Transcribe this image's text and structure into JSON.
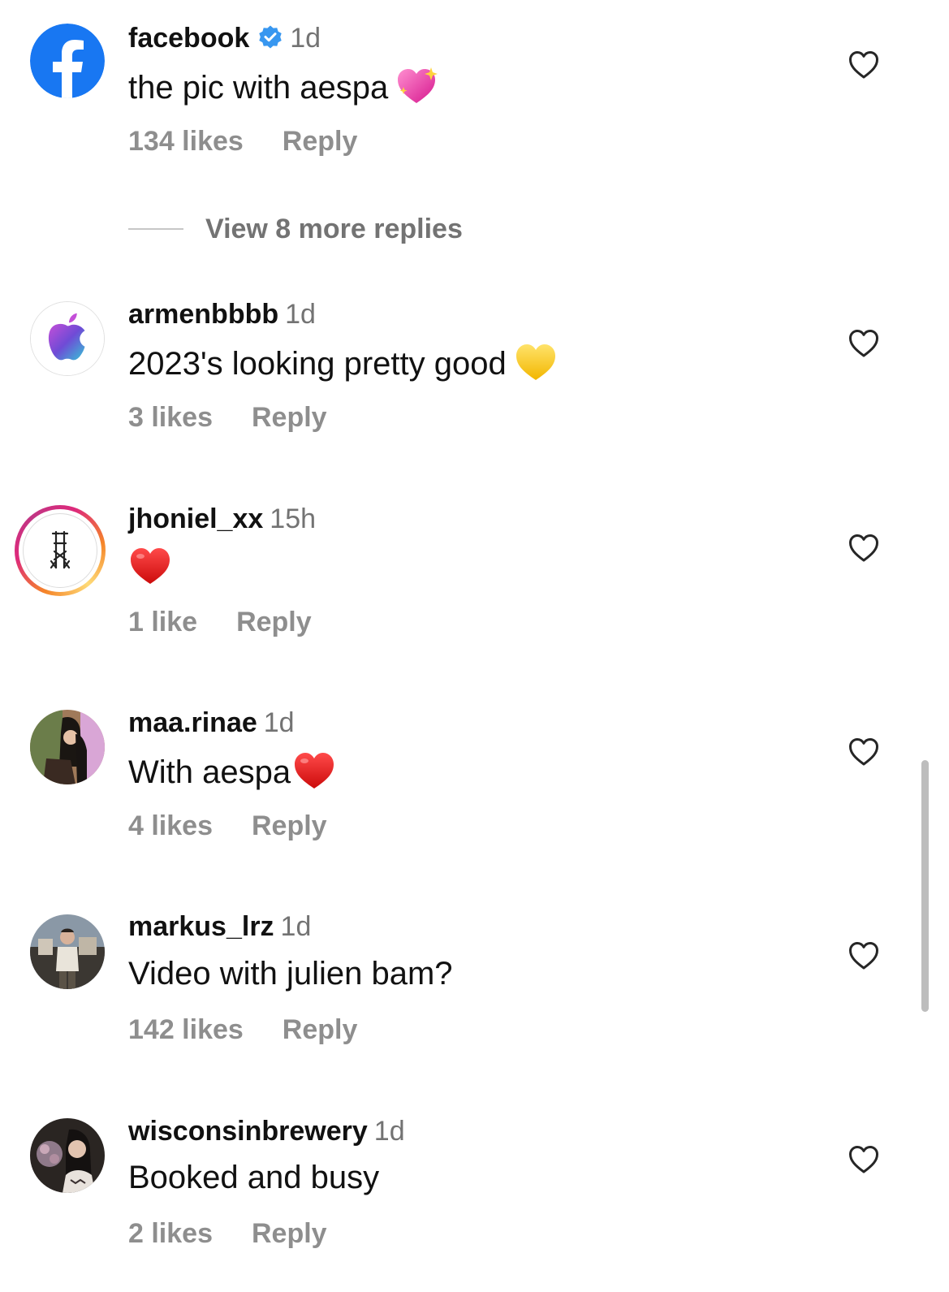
{
  "comments": [
    {
      "username": "facebook",
      "verified": true,
      "time": "1d",
      "text": "the pic with aespa",
      "emoji": "sparkling-heart",
      "likes": "134 likes",
      "reply": "Reply",
      "avatar": "facebook-logo"
    },
    {
      "username": "armenbbbb",
      "time": "1d",
      "text": "2023's looking pretty good",
      "emoji": "yellow-heart",
      "likes": "3 likes",
      "reply": "Reply",
      "avatar": "apple-logo"
    },
    {
      "username": "jhoniel_xx",
      "time": "15h",
      "text": "",
      "emoji": "red-heart",
      "likes": "1 like",
      "reply": "Reply",
      "avatar": "monogram-logo-with-story-ring"
    },
    {
      "username": "maa.rinae",
      "time": "1d",
      "text": "With aespa",
      "emoji": "red-heart",
      "likes": "4 likes",
      "reply": "Reply",
      "avatar": "photo"
    },
    {
      "username": "markus_lrz",
      "time": "1d",
      "text": "Video with julien bam?",
      "likes": "142 likes",
      "reply": "Reply",
      "avatar": "photo"
    },
    {
      "username": "wisconsinbrewery",
      "time": "1d",
      "text": "Booked and busy",
      "likes": "2 likes",
      "reply": "Reply",
      "avatar": "photo"
    }
  ],
  "view_replies": "View 8 more replies",
  "colors": {
    "username": "#111111",
    "secondary": "#8e8e8e",
    "verified": "#3897f0",
    "facebook_blue": "#1877f2"
  }
}
